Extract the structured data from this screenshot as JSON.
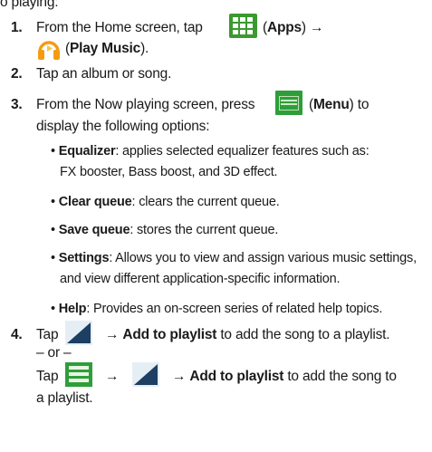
{
  "top_fragment": "o playing:",
  "steps": [
    {
      "number": "1.",
      "line1_pre": "From the Home screen, tap",
      "line1_paren_open": "(",
      "line1_bold": "Apps",
      "line1_paren_close": ") →",
      "line2_paren_open": "(",
      "line2_bold": "Play Music",
      "line2_paren_close": ").",
      "icon_apps": "apps-grid-icon",
      "icon_music": "headphones-icon"
    },
    {
      "number": "2.",
      "text": "Tap an album or song."
    },
    {
      "number": "3.",
      "line1_pre": "From the Now playing screen, press",
      "line1_paren_open": "(",
      "line1_bold": "Menu",
      "line1_paren_close": ") to",
      "line2": "display the following options:",
      "icon_menu": "menu-icon",
      "bullets": [
        {
          "term": "Equalizer",
          "rest": ": applies selected equalizer features such as:",
          "cont": "FX booster, Bass boost, and 3D effect."
        },
        {
          "term": "Clear queue",
          "rest": ": clears the current queue."
        },
        {
          "term": "Save queue",
          "rest": ": stores the current queue."
        },
        {
          "term": "Settings",
          "rest": ": Allows you to view and assign various music settings,",
          "cont": "and view different application-specific information."
        },
        {
          "term": "Help",
          "rest": ": Provides an on-screen series of related help topics."
        }
      ]
    },
    {
      "number": "4.",
      "tap": "Tap",
      "arrow": "→",
      "bold": "Add to playlist",
      "line1_rest": " to add the song to a playlist.",
      "or_text": "– or –",
      "line3_rest": " to add the song to",
      "line4": "a playlist.",
      "icon_add": "add-to-playlist-icon",
      "icon_list": "list-icon"
    }
  ],
  "colors": {
    "icon_green": "#3a9a2f",
    "icon_dark": "#1c3f63",
    "icon_light": "#e6eef5"
  }
}
